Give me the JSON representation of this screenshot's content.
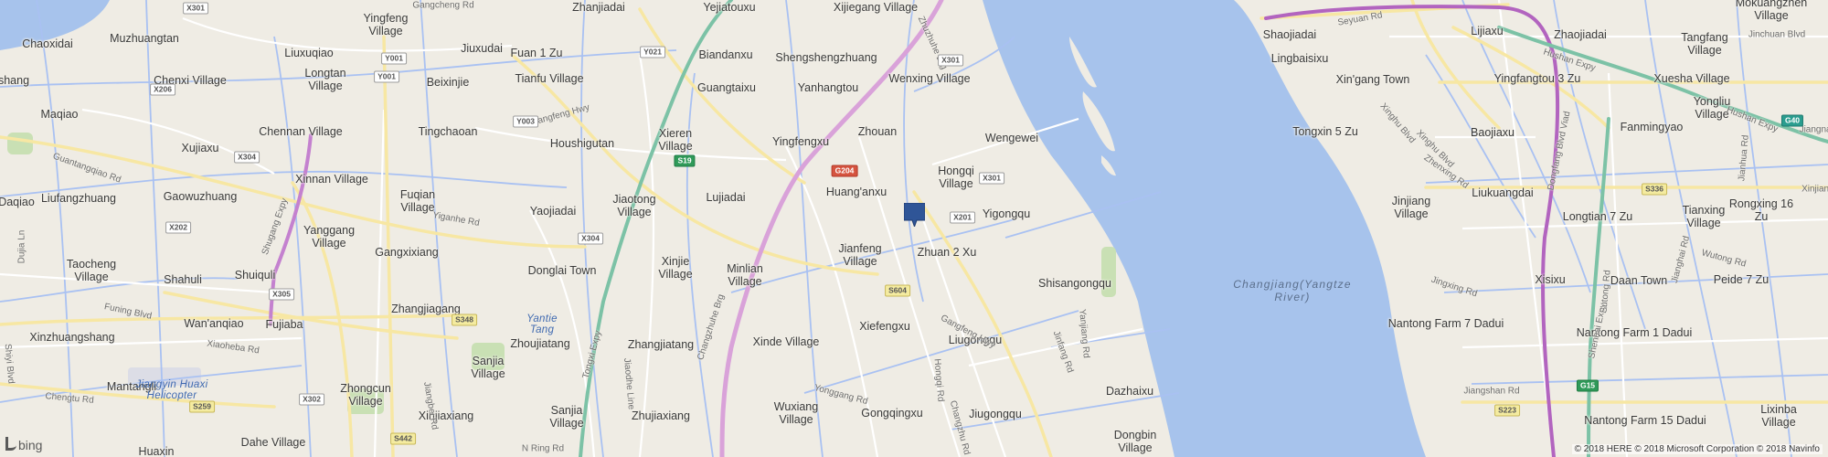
{
  "map": {
    "pin_icon": "location-pin-icon",
    "pin_color": "#2f5597",
    "water_color": "#a7c3ec",
    "land_color": "#efece4",
    "highway_color": "#e0a9df",
    "primary_road_color": "#f7e7a3",
    "canal_color": "#a9c1f2",
    "logo_text": "bing",
    "copyright": "© 2018 HERE © 2018 Microsoft Corporation © 2018 Navinfo"
  },
  "places": [
    {
      "name": "Zhanjiadai"
    },
    {
      "name": "Yejiatouxu"
    },
    {
      "name": "Xijiegang Village"
    },
    {
      "name": "Chaoxidai"
    },
    {
      "name": "Muzhuangtan"
    },
    {
      "name": "Yingfeng\nVillage"
    },
    {
      "name": "Liuxuqiao"
    },
    {
      "name": "Jiuxudai"
    },
    {
      "name": "Fuan 1 Zu"
    },
    {
      "name": "Biandanxu"
    },
    {
      "name": "Shengshengzhuang"
    },
    {
      "name": "shang"
    },
    {
      "name": "Chenxi Village"
    },
    {
      "name": "Longtan\nVillage"
    },
    {
      "name": "Beixinjie"
    },
    {
      "name": "Tianfu Village"
    },
    {
      "name": "Guangtaixu"
    },
    {
      "name": "Yanhangtou"
    },
    {
      "name": "Wenxing Village"
    },
    {
      "name": "Maqiao"
    },
    {
      "name": "Chennan Village"
    },
    {
      "name": "Tingchaoan"
    },
    {
      "name": "Houshigutan"
    },
    {
      "name": "Xieren\nVillage"
    },
    {
      "name": "Yingfengxu"
    },
    {
      "name": "Zhouan"
    },
    {
      "name": "Wengewei"
    },
    {
      "name": "Xujiaxu"
    },
    {
      "name": "Xinnan Village"
    },
    {
      "name": "Hongqi\nVillage"
    },
    {
      "name": "Liufangzhuang"
    },
    {
      "name": "Gaowuzhuang"
    },
    {
      "name": "Fuqian\nVillage"
    },
    {
      "name": "Yaojiadai"
    },
    {
      "name": "Jiaotong\nVillage"
    },
    {
      "name": "Lujiadai"
    },
    {
      "name": "Huang'anxu"
    },
    {
      "name": "Yigongqu"
    },
    {
      "name": "Daqiao"
    },
    {
      "name": "Yanggang\nVillage"
    },
    {
      "name": "Gangxixiang"
    },
    {
      "name": "Jianfeng\nVillage"
    },
    {
      "name": "Zhuan 2 Xu"
    },
    {
      "name": "Taocheng\nVillage"
    },
    {
      "name": "Donglai Town"
    },
    {
      "name": "Xinjie\nVillage"
    },
    {
      "name": "Minlian\nVillage"
    },
    {
      "name": "Shahuli"
    },
    {
      "name": "Shuiquli"
    },
    {
      "name": "Shisangongqu"
    },
    {
      "name": "Zhangjiagang"
    },
    {
      "name": "Wan'anqiao"
    },
    {
      "name": "Fujiaba"
    },
    {
      "name": "Xiefengxu"
    },
    {
      "name": "Xinzhuangshang"
    },
    {
      "name": "Zhoujiatang"
    },
    {
      "name": "Zhangjiatang"
    },
    {
      "name": "Xinde Village"
    },
    {
      "name": "Liugongqu"
    },
    {
      "name": "Sanjia\nVillage"
    },
    {
      "name": "Mantangli"
    },
    {
      "name": "Zhongcun\nVillage"
    },
    {
      "name": "Dazhaixu"
    },
    {
      "name": "Sanjia\nVillage"
    },
    {
      "name": "Zhujiaxiang"
    },
    {
      "name": "Wuxiang\nVillage"
    },
    {
      "name": "Gongqingxu"
    },
    {
      "name": "Jiugongqu"
    },
    {
      "name": "Xinjiaxiang"
    },
    {
      "name": "Huaxin"
    },
    {
      "name": "Dahe Village"
    },
    {
      "name": "Dongbin\nVillage"
    },
    {
      "name": "Shaojiadai"
    },
    {
      "name": "Lijiaxu"
    },
    {
      "name": "Zhaojiadai"
    },
    {
      "name": "Tangfang\nVillage"
    },
    {
      "name": "Mokuangzhen\nVillage"
    },
    {
      "name": "Lingbaisixu"
    },
    {
      "name": "Xin'gang Town"
    },
    {
      "name": "Yingfangtou 3 Zu"
    },
    {
      "name": "Xuesha Village"
    },
    {
      "name": "Tongxin 5 Zu"
    },
    {
      "name": "Baojiaxu"
    },
    {
      "name": "Fanmingyao"
    },
    {
      "name": "Yongliu\nVillage"
    },
    {
      "name": "Liukuangdai"
    },
    {
      "name": "Jinjiang\nVillage"
    },
    {
      "name": "Longtian 7 Zu"
    },
    {
      "name": "Tianxing\nVillage"
    },
    {
      "name": "Rongxing 16 Zu"
    },
    {
      "name": "Xisixu"
    },
    {
      "name": "Daan Town"
    },
    {
      "name": "Peide 7 Zu"
    },
    {
      "name": "Nantong Farm 7 Dadui"
    },
    {
      "name": "Nantong Farm 1 Dadui"
    },
    {
      "name": "Nantong Farm 15 Dadui"
    },
    {
      "name": "Lixinba\nVillage"
    }
  ],
  "roads": [
    {
      "name": "Gangfeng Hwy"
    },
    {
      "name": "Guantangqiao Rd"
    },
    {
      "name": "Funing Blvd"
    },
    {
      "name": "Xiaoheba Rd"
    },
    {
      "name": "Chengtu Rd"
    },
    {
      "name": "Shugang Expy"
    },
    {
      "name": "Tongxi Expy"
    },
    {
      "name": "Changzhuhe Brg"
    },
    {
      "name": "Gangfeng Hwy"
    },
    {
      "name": "Yiganhe Rd"
    },
    {
      "name": "Yonggang Rd"
    },
    {
      "name": "Jinfang Rd"
    },
    {
      "name": "Jiangbei Rd"
    },
    {
      "name": "Hongqi Rd"
    },
    {
      "name": "Yanjiang Rd"
    },
    {
      "name": "Dujia Ln"
    },
    {
      "name": "Shiyi Blvd"
    },
    {
      "name": "Jiaodhe Line"
    },
    {
      "name": "Changzhu Rd"
    },
    {
      "name": "N Ring Rd"
    },
    {
      "name": "Gangcheng Rd"
    },
    {
      "name": "Seyuan Rd"
    },
    {
      "name": "Hushan Expy"
    },
    {
      "name": "Hushan Expy"
    },
    {
      "name": "Xinghu Blvd"
    },
    {
      "name": "Xinghu Blvd"
    },
    {
      "name": "Zhenxing Rd"
    },
    {
      "name": "Dongfang Blvd Viad"
    },
    {
      "name": "Shenhai Expy"
    },
    {
      "name": "Wutong Rd"
    },
    {
      "name": "Jingxing Rd"
    },
    {
      "name": "Jiangshan Rd"
    },
    {
      "name": "Jianghai Rd"
    },
    {
      "name": "Sutong Rd"
    },
    {
      "name": "Jinchuan Blvd"
    },
    {
      "name": "Jianhua Rd"
    },
    {
      "name": "Jiangnan Blvd"
    },
    {
      "name": "Xinjiang Blvd"
    },
    {
      "name": "Zhuzhuhe Brg"
    }
  ],
  "shields": [
    {
      "code": "X301"
    },
    {
      "code": "Y001"
    },
    {
      "code": "Y001"
    },
    {
      "code": "Y021"
    },
    {
      "code": "X301"
    },
    {
      "code": "X206"
    },
    {
      "code": "Y003"
    },
    {
      "code": "X304"
    },
    {
      "code": "S19"
    },
    {
      "code": "G204"
    },
    {
      "code": "X301"
    },
    {
      "code": "X202"
    },
    {
      "code": "X201"
    },
    {
      "code": "X304"
    },
    {
      "code": "X305"
    },
    {
      "code": "S604"
    },
    {
      "code": "S348"
    },
    {
      "code": "S259"
    },
    {
      "code": "X302"
    },
    {
      "code": "S442"
    },
    {
      "code": "G40"
    },
    {
      "code": "S336"
    },
    {
      "code": "G15"
    },
    {
      "code": "S223"
    }
  ],
  "water_labels": [
    {
      "name": "Changjiang(Yangtze\nRiver)"
    },
    {
      "name": "Yantie\nTang"
    },
    {
      "name": "Jiangyin Huaxi\nHelicopter"
    }
  ]
}
